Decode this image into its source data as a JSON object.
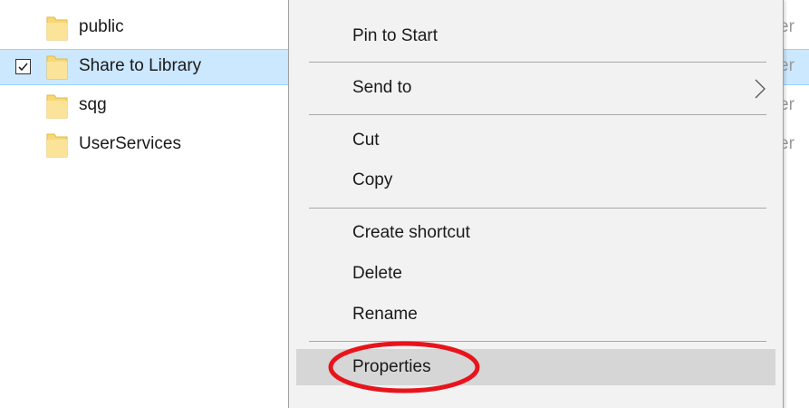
{
  "file_list": {
    "rows": [
      {
        "name": "public",
        "selected": false,
        "checked": false,
        "peek": "er"
      },
      {
        "name": "Share to Library",
        "selected": true,
        "checked": true,
        "peek": "er"
      },
      {
        "name": "sqg",
        "selected": false,
        "checked": false,
        "peek": "er"
      },
      {
        "name": "UserServices",
        "selected": false,
        "checked": false,
        "peek": "er"
      }
    ]
  },
  "context_menu": {
    "items": [
      {
        "label": "Pin to Start",
        "has_submenu": false,
        "highlighted": false
      },
      {
        "label": "Send to",
        "has_submenu": true,
        "highlighted": false
      },
      {
        "label": "Cut",
        "has_submenu": false,
        "highlighted": false
      },
      {
        "label": "Copy",
        "has_submenu": false,
        "highlighted": false
      },
      {
        "label": "Create shortcut",
        "has_submenu": false,
        "highlighted": false
      },
      {
        "label": "Delete",
        "has_submenu": false,
        "highlighted": false
      },
      {
        "label": "Rename",
        "has_submenu": false,
        "highlighted": false
      },
      {
        "label": "Properties",
        "has_submenu": false,
        "highlighted": true
      }
    ]
  },
  "icons": {
    "folder": "folder-icon",
    "checkbox": "checkbox-checked-icon",
    "submenu": "chevron-right-icon"
  },
  "colors": {
    "selection_bg": "#cce8ff",
    "menu_bg": "#f2f2f2",
    "menu_highlight": "#d6d6d6",
    "folder": "#f8d775",
    "annotation": "#e8141b"
  }
}
